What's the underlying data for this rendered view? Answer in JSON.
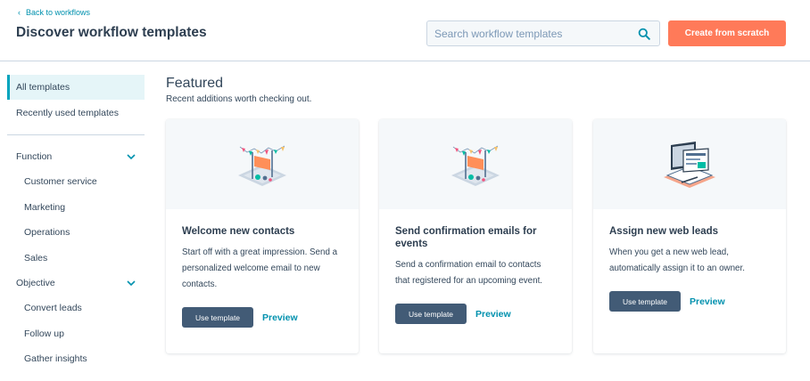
{
  "header": {
    "back_label": "Back to workflows",
    "title": "Discover workflow templates",
    "search_placeholder": "Search workflow templates",
    "search_value": "",
    "create_label": "Create from scratch"
  },
  "sidebar": {
    "top_items": [
      {
        "label": "All templates",
        "active": true
      },
      {
        "label": "Recently used templates",
        "active": false
      }
    ],
    "function": {
      "label": "Function",
      "items": [
        "Customer service",
        "Marketing",
        "Operations",
        "Sales"
      ]
    },
    "objective": {
      "label": "Objective",
      "items": [
        "Convert leads",
        "Follow up",
        "Gather insights"
      ]
    }
  },
  "main": {
    "featured_title": "Featured",
    "featured_subtitle": "Recent additions worth checking out.",
    "cards": [
      {
        "icon": "celebration-banner-icon",
        "title": "Welcome new contacts",
        "description": "Start off with a great impression. Send a personalized welcome email to new contacts.",
        "use_label": "Use template",
        "preview_label": "Preview"
      },
      {
        "icon": "celebration-banner-icon",
        "title": "Send confirmation emails for events",
        "description": "Send a confirmation email to contacts that registered for an upcoming event.",
        "use_label": "Use template",
        "preview_label": "Preview"
      },
      {
        "icon": "web-laptop-icon",
        "title": "Assign new web leads",
        "description": "When you get a new web lead, automatically assign it to an owner.",
        "use_label": "Use template",
        "preview_label": "Preview"
      }
    ]
  },
  "colors": {
    "accent_orange": "#ff7a59",
    "link_teal": "#0091ae",
    "button_slate": "#425b76",
    "active_bg": "#e5f5f8"
  }
}
